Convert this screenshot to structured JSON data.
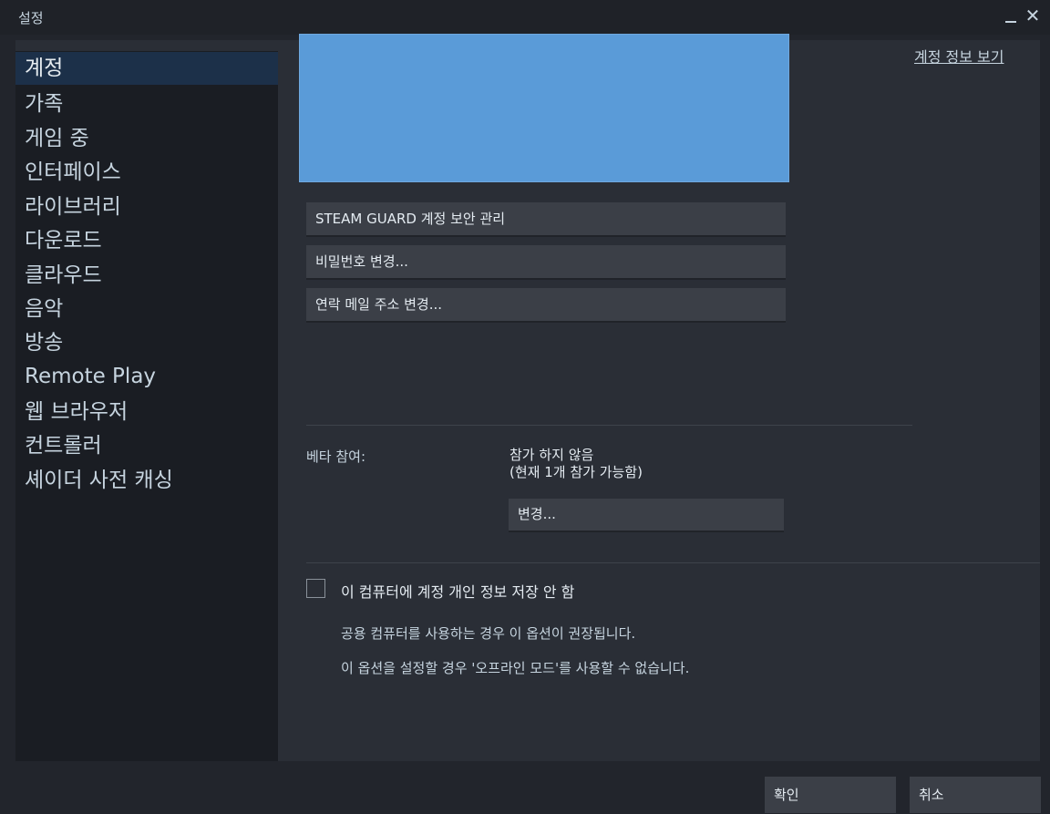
{
  "window": {
    "title": "설정",
    "minimize_label": "_",
    "close_label": "✕"
  },
  "sidebar": {
    "items": [
      {
        "label": "계정",
        "active": true
      },
      {
        "label": "가족"
      },
      {
        "label": "게임 중"
      },
      {
        "label": "인터페이스"
      },
      {
        "label": "라이브러리"
      },
      {
        "label": "다운로드"
      },
      {
        "label": "클라우드"
      },
      {
        "label": "음악"
      },
      {
        "label": "방송"
      },
      {
        "label": "Remote Play"
      },
      {
        "label": "웹 브라우저"
      },
      {
        "label": "컨트롤러"
      },
      {
        "label": "셰이더 사전 캐싱"
      }
    ]
  },
  "account": {
    "view_info_link": "계정 정보 보기",
    "steam_guard_button": "STEAM GUARD 계정 보안 관리",
    "change_password_button": "비밀번호 변경...",
    "change_email_button": "연락 메일 주소 변경..."
  },
  "beta": {
    "label": "베타 참여:",
    "status_line1": "참가 하지 않음",
    "status_line2": "(현재 1개 참가 가능함)",
    "change_button": "변경..."
  },
  "privacy": {
    "checkbox_label": "이 컴퓨터에 계정 개인 정보 저장 안 함",
    "checked": false,
    "note1": "공용 컴퓨터를 사용하는 경우 이 옵션이 권장됩니다.",
    "note2": "이 옵션을 설정할 경우 '오프라인 모드'를 사용할 수 없습니다."
  },
  "footer": {
    "ok_label": "확인",
    "cancel_label": "취소"
  },
  "colors": {
    "background": "#22252c",
    "sidebar": "#1a1d23",
    "content": "#2a2e36",
    "active_item": "#1c3049",
    "avatar_placeholder": "#5a9bd8",
    "button": "#3b3f47"
  }
}
